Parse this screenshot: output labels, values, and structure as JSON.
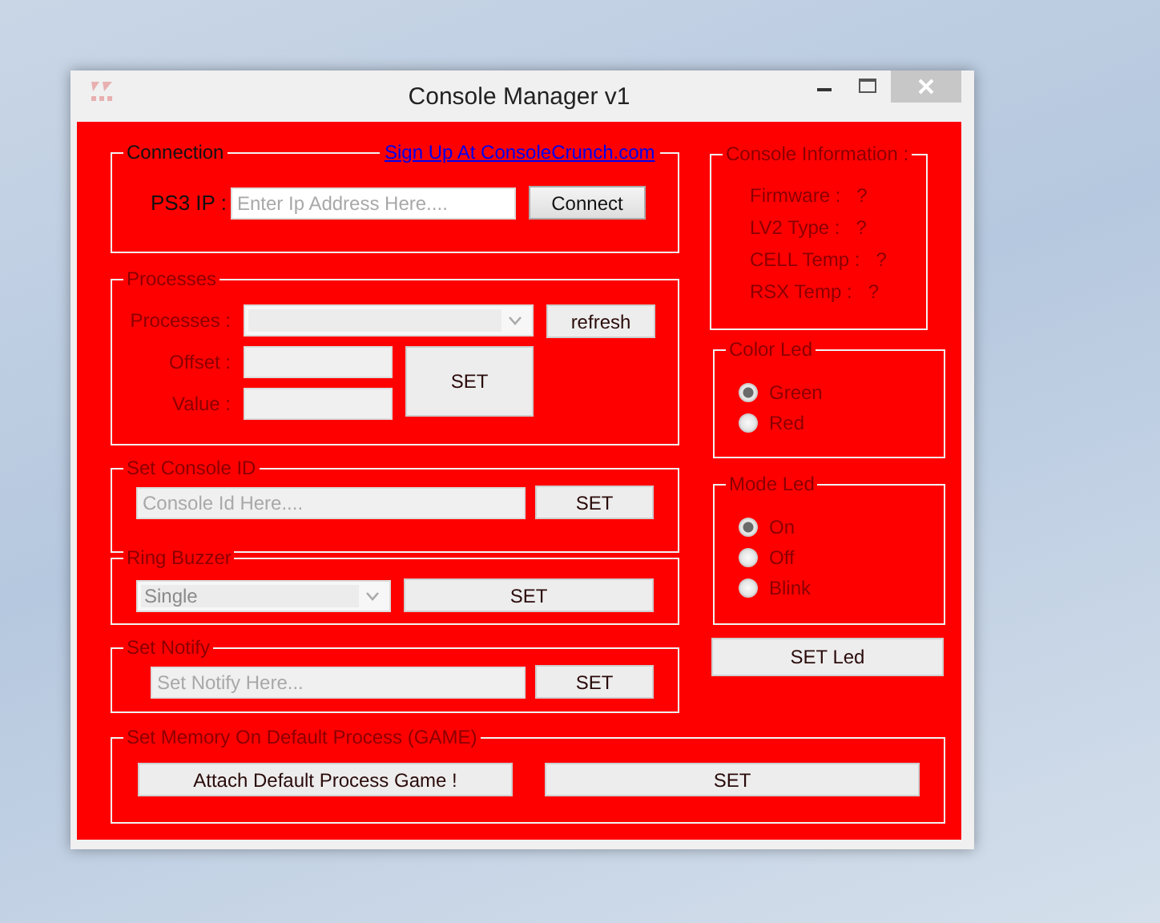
{
  "window": {
    "title": "Console Manager v1"
  },
  "connection": {
    "legend": "Connection",
    "link": "Sign Up At ConsoleCrunch.com",
    "ip_label": "PS3 IP :",
    "ip_placeholder": "Enter Ip Address Here....",
    "button": "Connect"
  },
  "processes": {
    "legend": "Processes",
    "process_label": "Processes :",
    "offset_label": "Offset :",
    "value_label": "Value :",
    "refresh_button": "refresh",
    "set_button": "SET"
  },
  "console_id": {
    "legend": "Set Console ID",
    "placeholder": "Console Id Here....",
    "button": "SET"
  },
  "buzzer": {
    "legend": "Ring Buzzer",
    "value": "Single",
    "button": "SET"
  },
  "notify": {
    "legend": "Set Notify",
    "placeholder": "Set Notify Here...",
    "button": "SET"
  },
  "memory": {
    "legend": "Set Memory On Default Process (GAME)",
    "attach_button": "Attach Default Process Game !",
    "set_button": "SET"
  },
  "console_info": {
    "legend": "Console Information :",
    "rows": [
      {
        "label": "Firmware :",
        "value": "?"
      },
      {
        "label": "LV2 Type :",
        "value": "?"
      },
      {
        "label": "CELL Temp :",
        "value": "?"
      },
      {
        "label": "RSX Temp :",
        "value": "?"
      }
    ]
  },
  "color_led": {
    "legend": "Color Led",
    "options": [
      {
        "label": "Green",
        "selected": true
      },
      {
        "label": "Red",
        "selected": false
      }
    ]
  },
  "mode_led": {
    "legend": "Mode Led",
    "options": [
      {
        "label": "On",
        "selected": true
      },
      {
        "label": "Off",
        "selected": false
      },
      {
        "label": "Blink",
        "selected": false
      }
    ]
  },
  "set_led_button": "SET Led"
}
